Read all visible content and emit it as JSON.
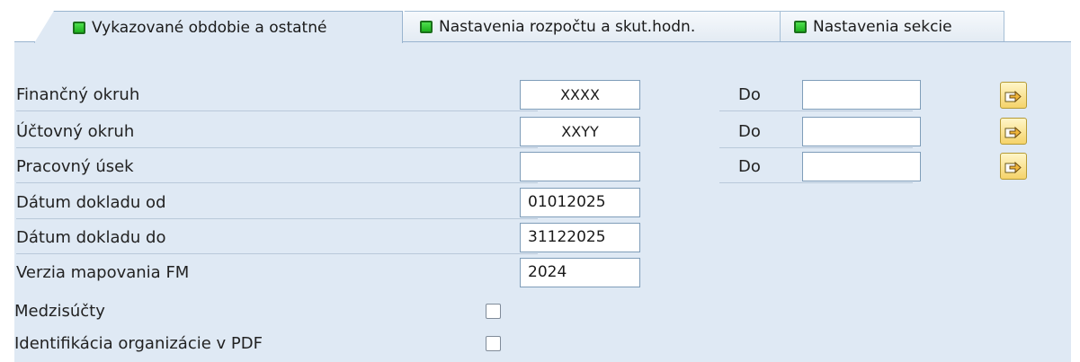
{
  "tabs": [
    {
      "label": "Vykazované obdobie a ostatné",
      "active": true
    },
    {
      "label": "Nastavenia rozpočtu a skut.hodn.",
      "active": false
    },
    {
      "label": "Nastavenia sekcie",
      "active": false
    }
  ],
  "fields": {
    "financny_okruh": {
      "label": "Finančný okruh",
      "value": "XXXX",
      "to_label": "Do",
      "to_value": ""
    },
    "uctovny_okruh": {
      "label": "Účtovný okruh",
      "value": "XXYY",
      "to_label": "Do",
      "to_value": ""
    },
    "pracovny_usek": {
      "label": "Pracovný úsek",
      "value": "",
      "to_label": "Do",
      "to_value": ""
    },
    "datum_od": {
      "label": "Dátum dokladu od",
      "value": "01012025"
    },
    "datum_do": {
      "label": "Dátum dokladu do",
      "value": "31122025"
    },
    "verzia": {
      "label": "Verzia mapovania FM",
      "value": "2024"
    }
  },
  "checkboxes": {
    "medzisucty": {
      "label": "Medzisúčty",
      "checked": false
    },
    "identifikacia": {
      "label": "Identifikácia organizácie v PDF",
      "checked": false
    }
  },
  "colors": {
    "panel_background": "#dfe9f4",
    "tab_icon": "#1db11d",
    "multiple_selection_button": "#f5d36a"
  },
  "icons": {
    "tab_status": "green-square-icon",
    "multiple_selection": "arrow-right-icon"
  }
}
